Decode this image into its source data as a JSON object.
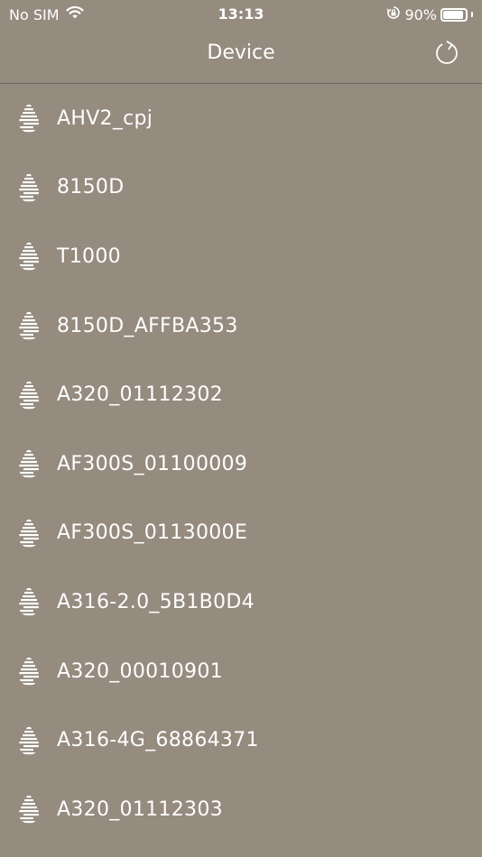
{
  "status_bar": {
    "carrier": "No SIM",
    "time": "13:13",
    "battery_percent": "90%",
    "battery_level": 0.9
  },
  "nav": {
    "title": "Device"
  },
  "icons": {
    "device": "water-drop-icon",
    "refresh": "refresh-icon",
    "wifi": "wifi-icon",
    "orientation_lock": "orientation-lock-icon"
  },
  "colors": {
    "background": "#958b7f",
    "foreground": "#ffffff",
    "divider": "#6f675e"
  },
  "devices": [
    {
      "name": "AHV2_cpj"
    },
    {
      "name": "8150D"
    },
    {
      "name": "T1000"
    },
    {
      "name": "8150D_AFFBA353"
    },
    {
      "name": "A320_01112302"
    },
    {
      "name": "AF300S_01100009"
    },
    {
      "name": "AF300S_0113000E"
    },
    {
      "name": "A316-2.0_5B1B0D4"
    },
    {
      "name": "A320_00010901"
    },
    {
      "name": "A316-4G_68864371"
    },
    {
      "name": "A320_01112303"
    }
  ]
}
